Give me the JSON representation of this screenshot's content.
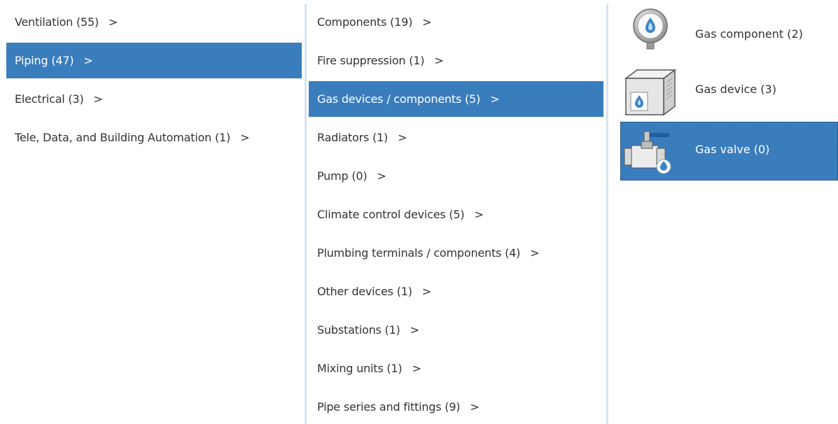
{
  "column1": {
    "items": [
      {
        "label": "Ventilation (55)",
        "arrow": ">"
      },
      {
        "label": "Piping (47)",
        "arrow": ">"
      },
      {
        "label": "Electrical (3)",
        "arrow": ">"
      },
      {
        "label": "Tele, Data, and Building Automation (1)",
        "arrow": ">"
      }
    ],
    "selected_index": 1
  },
  "column2": {
    "items": [
      {
        "label": "Components (19)",
        "arrow": ">"
      },
      {
        "label": "Fire suppression (1)",
        "arrow": ">"
      },
      {
        "label": "Gas devices / components (5)",
        "arrow": ">"
      },
      {
        "label": "Radiators (1)",
        "arrow": ">"
      },
      {
        "label": "Pump (0)",
        "arrow": ">"
      },
      {
        "label": "Climate control devices (5)",
        "arrow": ">"
      },
      {
        "label": "Plumbing terminals / components (4)",
        "arrow": ">"
      },
      {
        "label": "Other devices (1)",
        "arrow": ">"
      },
      {
        "label": "Substations (1)",
        "arrow": ">"
      },
      {
        "label": "Mixing units (1)",
        "arrow": ">"
      },
      {
        "label": "Pipe series and fittings (9)",
        "arrow": ">"
      }
    ],
    "selected_index": 2
  },
  "column3": {
    "items": [
      {
        "label": "Gas component (2)",
        "icon": "pressure-gauge-icon"
      },
      {
        "label": "Gas device (3)",
        "icon": "gas-device-box-icon"
      },
      {
        "label": "Gas valve (0)",
        "icon": "gas-valve-icon"
      }
    ],
    "selected_index": 2
  },
  "colors": {
    "selected_bg": "#3a7dbd",
    "selected_text": "#ffffff",
    "text": "#333333",
    "divider": "#d6e3f0"
  }
}
